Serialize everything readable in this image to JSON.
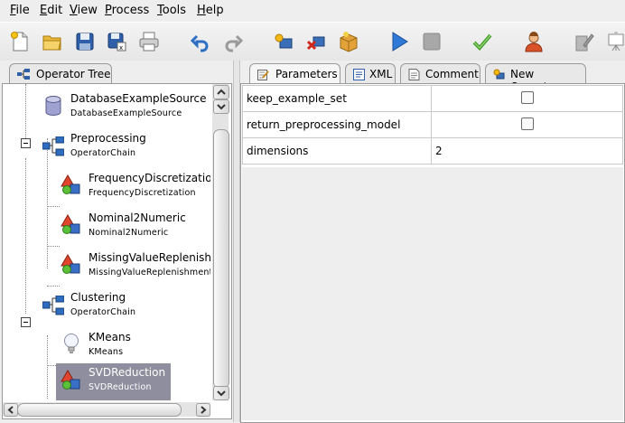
{
  "menu": [
    "File",
    "Edit",
    "View",
    "Process",
    "Tools",
    "Help"
  ],
  "left_tab": {
    "label": "Operator Tree"
  },
  "right_tabs": [
    {
      "label": "Parameters",
      "icon": "parameters-icon"
    },
    {
      "label": "XML",
      "icon": "xml-icon"
    },
    {
      "label": "Comment",
      "icon": "comment-icon"
    },
    {
      "label": "New Operator",
      "icon": "new-operator-icon"
    }
  ],
  "tree": [
    {
      "name": "DatabaseExampleSource",
      "type": "DatabaseExampleSource",
      "icon": "database-icon"
    },
    {
      "name": "Preprocessing",
      "type": "OperatorChain",
      "icon": "operator-chain-icon"
    },
    {
      "name": "FrequencyDiscretization",
      "type": "FrequencyDiscretization",
      "icon": "preprocessing-operator-icon"
    },
    {
      "name": "Nominal2Numeric",
      "type": "Nominal2Numeric",
      "icon": "preprocessing-operator-icon"
    },
    {
      "name": "MissingValueReplenishn",
      "type": "MissingValueReplenishment",
      "icon": "preprocessing-operator-icon"
    },
    {
      "name": "Clustering",
      "type": "OperatorChain",
      "icon": "operator-chain-icon"
    },
    {
      "name": "KMeans",
      "type": "KMeans",
      "icon": "lightbulb-icon"
    },
    {
      "name": "SVDReduction",
      "type": "SVDReduction",
      "icon": "preprocessing-operator-icon",
      "selected": true
    }
  ],
  "params": [
    {
      "key": "keep_example_set",
      "value": "",
      "type": "checkbox",
      "checked": false
    },
    {
      "key": "return_preprocessing_model",
      "value": "",
      "type": "checkbox",
      "checked": false
    },
    {
      "key": "dimensions",
      "value": "2",
      "type": "text"
    }
  ]
}
